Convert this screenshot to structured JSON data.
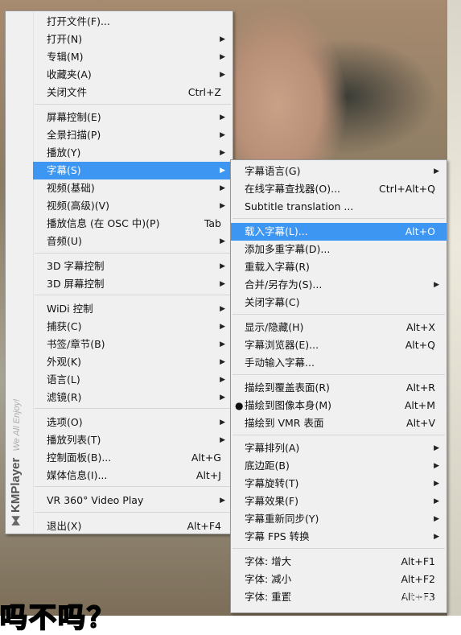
{
  "background": {
    "subtitle_text": "吗不吗？",
    "watermark": "https://blog.csdn.net/u011416"
  },
  "brand": {
    "icon": "⧓",
    "name": "KMPlayer",
    "tagline": "We All Enjoy!"
  },
  "main_menu": {
    "items": [
      {
        "label": "打开文件(F)...",
        "shortcut": "",
        "submenu": false
      },
      {
        "label": "打开(N)",
        "shortcut": "",
        "submenu": true
      },
      {
        "label": "专辑(M)",
        "shortcut": "",
        "submenu": true
      },
      {
        "label": "收藏夹(A)",
        "shortcut": "",
        "submenu": true
      },
      {
        "label": "关闭文件",
        "shortcut": "Ctrl+Z",
        "submenu": false
      },
      {
        "label": "屏幕控制(E)",
        "shortcut": "",
        "submenu": true
      },
      {
        "label": "全景扫描(P)",
        "shortcut": "",
        "submenu": true
      },
      {
        "label": "播放(Y)",
        "shortcut": "",
        "submenu": true
      },
      {
        "label": "字幕(S)",
        "shortcut": "",
        "submenu": true
      },
      {
        "label": "视频(基础)",
        "shortcut": "",
        "submenu": true
      },
      {
        "label": "视频(高级)(V)",
        "shortcut": "",
        "submenu": true
      },
      {
        "label": "播放信息 (在 OSC 中)(P)",
        "shortcut": "Tab",
        "submenu": false
      },
      {
        "label": "音频(U)",
        "shortcut": "",
        "submenu": true
      },
      {
        "label": "3D 字幕控制",
        "shortcut": "",
        "submenu": true
      },
      {
        "label": "3D 屏幕控制",
        "shortcut": "",
        "submenu": true
      },
      {
        "label": "WiDi 控制",
        "shortcut": "",
        "submenu": true
      },
      {
        "label": "捕获(C)",
        "shortcut": "",
        "submenu": true
      },
      {
        "label": "书签/章节(B)",
        "shortcut": "",
        "submenu": true
      },
      {
        "label": "外观(K)",
        "shortcut": "",
        "submenu": true
      },
      {
        "label": "语言(L)",
        "shortcut": "",
        "submenu": true
      },
      {
        "label": "滤镜(R)",
        "shortcut": "",
        "submenu": true
      },
      {
        "label": "选项(O)",
        "shortcut": "",
        "submenu": true
      },
      {
        "label": "播放列表(T)",
        "shortcut": "",
        "submenu": true
      },
      {
        "label": "控制面板(B)...",
        "shortcut": "Alt+G",
        "submenu": false
      },
      {
        "label": "媒体信息(I)...",
        "shortcut": "Alt+J",
        "submenu": false
      },
      {
        "label": "VR 360° Video Play",
        "shortcut": "",
        "submenu": true
      },
      {
        "label": "退出(X)",
        "shortcut": "Alt+F4",
        "submenu": false
      }
    ]
  },
  "subtitle_menu": {
    "items": [
      {
        "label": "字幕语言(G)",
        "shortcut": "",
        "submenu": true
      },
      {
        "label": "在线字幕查找器(O)...",
        "shortcut": "Ctrl+Alt+Q",
        "submenu": false
      },
      {
        "label": "Subtitle translation ...",
        "shortcut": "",
        "submenu": false
      },
      {
        "label": "载入字幕(L)...",
        "shortcut": "Alt+O",
        "submenu": false
      },
      {
        "label": "添加多重字幕(D)...",
        "shortcut": "",
        "submenu": false
      },
      {
        "label": "重载入字幕(R)",
        "shortcut": "",
        "submenu": false
      },
      {
        "label": "合并/另存为(S)...",
        "shortcut": "",
        "submenu": true
      },
      {
        "label": "关闭字幕(C)",
        "shortcut": "",
        "submenu": false
      },
      {
        "label": "显示/隐藏(H)",
        "shortcut": "Alt+X",
        "submenu": false
      },
      {
        "label": "字幕浏览器(E)...",
        "shortcut": "Alt+Q",
        "submenu": false
      },
      {
        "label": "手动输入字幕...",
        "shortcut": "",
        "submenu": false
      },
      {
        "label": "描绘到覆盖表面(R)",
        "shortcut": "Alt+R",
        "submenu": false
      },
      {
        "label": "描绘到图像本身(M)",
        "shortcut": "Alt+M",
        "submenu": false,
        "selected": true
      },
      {
        "label": "描绘到 VMR 表面",
        "shortcut": "Alt+V",
        "submenu": false
      },
      {
        "label": "字幕排列(A)",
        "shortcut": "",
        "submenu": true
      },
      {
        "label": "底边距(B)",
        "shortcut": "",
        "submenu": true
      },
      {
        "label": "字幕旋转(T)",
        "shortcut": "",
        "submenu": true
      },
      {
        "label": "字幕效果(F)",
        "shortcut": "",
        "submenu": true
      },
      {
        "label": "字幕重新同步(Y)",
        "shortcut": "",
        "submenu": true
      },
      {
        "label": "字幕 FPS 转换",
        "shortcut": "",
        "submenu": true
      },
      {
        "label": "字体: 增大",
        "shortcut": "Alt+F1",
        "submenu": false
      },
      {
        "label": "字体: 减小",
        "shortcut": "Alt+F2",
        "submenu": false
      },
      {
        "label": "字体: 重置",
        "shortcut": "Alt+F3",
        "submenu": false
      }
    ]
  },
  "colors": {
    "highlight": "#3d96f2",
    "menu_bg": "#f0f0f0"
  }
}
